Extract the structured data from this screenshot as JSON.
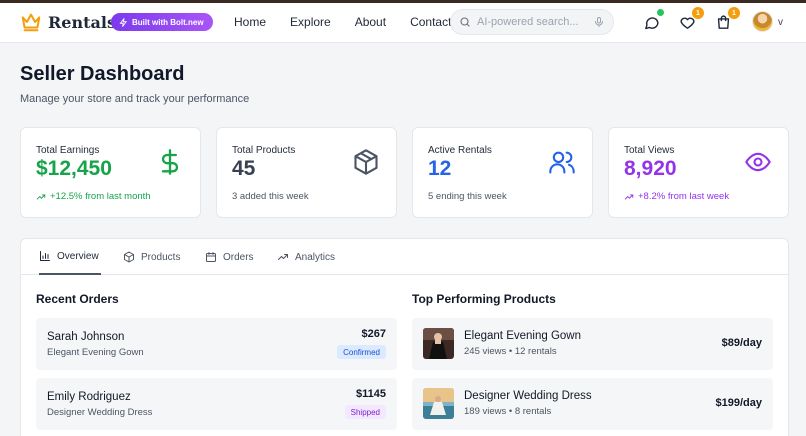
{
  "brand": {
    "name": "Rentals",
    "badge": "Built with Bolt.new"
  },
  "nav": {
    "links": [
      "Home",
      "Explore",
      "About",
      "Contact"
    ]
  },
  "search": {
    "placeholder": "AI-powered search..."
  },
  "header_icons": {
    "wishlist_count": "1",
    "cart_count": "1"
  },
  "user": {
    "initial": "v"
  },
  "page": {
    "title": "Seller Dashboard",
    "subtitle": "Manage your store and track your performance"
  },
  "stats": [
    {
      "label": "Total Earnings",
      "value": "$12,450",
      "note": "+12.5% from last month",
      "color": "#16a34a",
      "icon": "dollar-icon"
    },
    {
      "label": "Total Products",
      "value": "45",
      "note": "3 added this week",
      "color": "#374151",
      "icon": "package-icon"
    },
    {
      "label": "Active Rentals",
      "value": "12",
      "note": "5 ending this week",
      "color": "#2563eb",
      "icon": "users-icon"
    },
    {
      "label": "Total Views",
      "value": "8,920",
      "note": "+8.2% from last week",
      "color": "#9333ea",
      "icon": "eye-icon"
    }
  ],
  "tabs": [
    {
      "label": "Overview",
      "icon": "bar-chart-icon",
      "active": true
    },
    {
      "label": "Products",
      "icon": "package-icon",
      "active": false
    },
    {
      "label": "Orders",
      "icon": "calendar-icon",
      "active": false
    },
    {
      "label": "Analytics",
      "icon": "trending-up-icon",
      "active": false
    }
  ],
  "recent_orders": {
    "title": "Recent Orders",
    "items": [
      {
        "customer": "Sarah Johnson",
        "product": "Elegant Evening Gown",
        "price": "$267",
        "status": "Confirmed"
      },
      {
        "customer": "Emily Rodriguez",
        "product": "Designer Wedding Dress",
        "price": "$1145",
        "status": "Shipped"
      }
    ]
  },
  "top_products": {
    "title": "Top Performing Products",
    "items": [
      {
        "name": "Elegant Evening Gown",
        "meta": "245 views • 12 rentals",
        "price": "$89/day"
      },
      {
        "name": "Designer Wedding Dress",
        "meta": "189 views • 8 rentals",
        "price": "$199/day"
      }
    ]
  },
  "colors": {
    "accent": "#7c3aed",
    "badge": "#f59e0b",
    "online": "#22c55e",
    "confirmed_bg": "#dbeafe",
    "confirmed_fg": "#1d4ed8",
    "shipped_bg": "#f3e8ff",
    "shipped_fg": "#7e22ce"
  }
}
